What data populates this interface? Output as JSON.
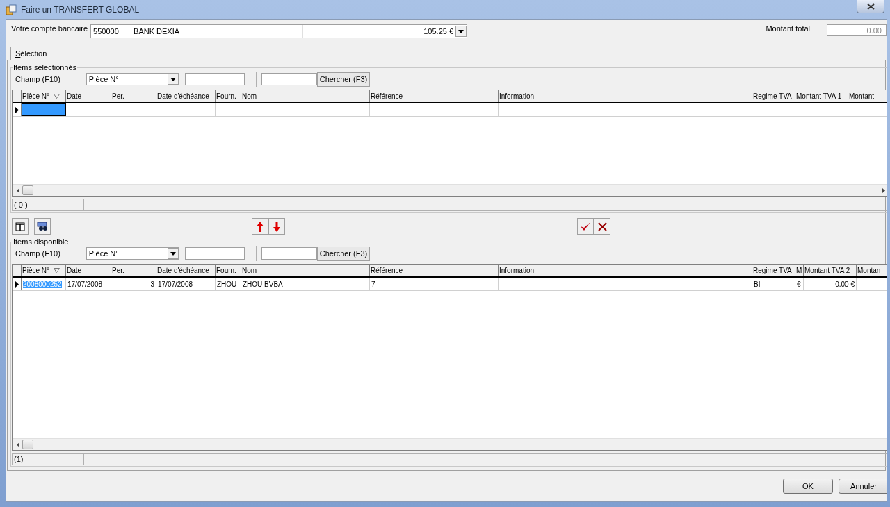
{
  "window": {
    "title": "Faire un TRANSFERT GLOBAL"
  },
  "account": {
    "label": "Votre compte bancaire",
    "number": "550000",
    "name": "BANK DEXIA",
    "balance": "105.25 €"
  },
  "total": {
    "label": "Montant total",
    "value": "0.00"
  },
  "tabs": [
    {
      "label": "Sélection",
      "selected": true
    }
  ],
  "selected_items": {
    "title": "Items sélectionnés",
    "field_label": "Champ (F10)",
    "field_value": "Pièce N°",
    "search_button": "Chercher (F3)",
    "columns": [
      {
        "label": "Pièce N°",
        "sorted": true
      },
      {
        "label": "Date"
      },
      {
        "label": "Per."
      },
      {
        "label": "Date d'échéance"
      },
      {
        "label": "Fourn."
      },
      {
        "label": "Nom"
      },
      {
        "label": "Référence"
      },
      {
        "label": "Information"
      },
      {
        "label": "Regime TVA"
      },
      {
        "label": "Montant TVA 1"
      },
      {
        "label": "Montant"
      }
    ],
    "rows": [
      {
        "selected": true
      }
    ],
    "count": "( 0 )"
  },
  "available_items": {
    "title": "Items disponible",
    "field_label": "Champ (F10)",
    "field_value": "Pièce N°",
    "search_button": "Chercher (F3)",
    "columns": [
      {
        "label": "Pièce N°",
        "sorted": true
      },
      {
        "label": "Date"
      },
      {
        "label": "Per."
      },
      {
        "label": "Date d'échéance"
      },
      {
        "label": "Fourn."
      },
      {
        "label": "Nom"
      },
      {
        "label": "Référence"
      },
      {
        "label": "Information"
      },
      {
        "label": "Regime TVA"
      },
      {
        "label": "M"
      },
      {
        "label": "Montant TVA 2"
      },
      {
        "label": "Montan"
      }
    ],
    "rows": [
      {
        "selected": true,
        "cells": [
          "2008000252",
          "17/07/2008",
          "3",
          "17/07/2008",
          "ZHOU",
          "ZHOU BVBA",
          "7",
          null,
          "BI",
          "€",
          "0.00 €",
          null
        ]
      }
    ],
    "count": "(1)"
  },
  "buttons": [
    {
      "label": "OK"
    },
    {
      "label": "Annuler"
    }
  ]
}
